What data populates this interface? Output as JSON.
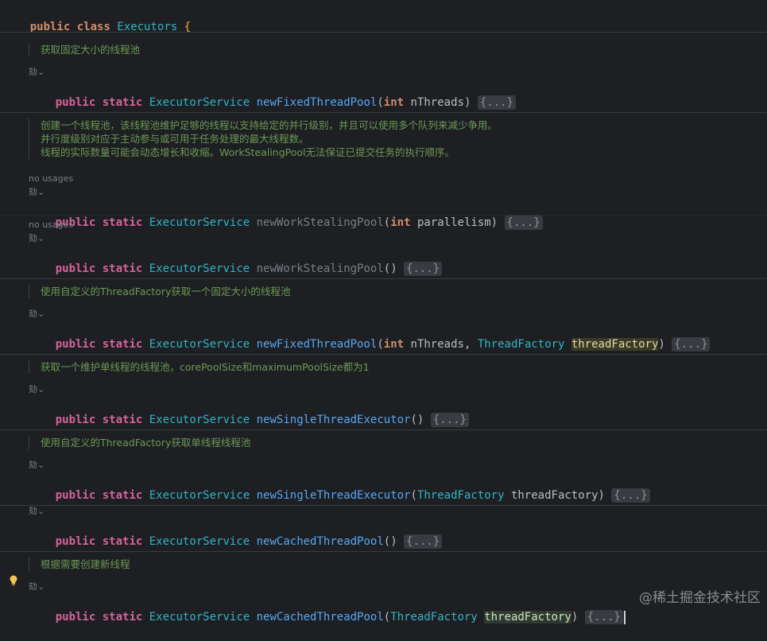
{
  "class_header": {
    "mod": "public",
    "kw": "class",
    "name": "Executors",
    "brace": "{"
  },
  "common": {
    "public": "public",
    "static": "static",
    "return_type": "ExecutorService",
    "fold": "{...}",
    "int": "int",
    "threadfactory_type": "ThreadFactory",
    "inlay": "劾⌄"
  },
  "docs": {
    "d1": "获取固定大小的线程池",
    "d2_l1": "创建一个线程池，该线程池维护足够的线程以支持给定的并行级别，并且可以使用多个队列来减少争用。",
    "d2_l2": "并行度级别对应于主动参与或可用于任务处理的最大线程数。",
    "d2_l3": "线程的实际数量可能会动态增长和收缩。WorkStealingPool无法保证已提交任务的执行顺序。",
    "d3": "使用自定义的ThreadFactory获取一个固定大小的线程池",
    "d4": "获取一个维护单线程的线程池，corePoolSize和maximumPoolSize都为1",
    "d5": "使用自定义的ThreadFactory获取单线程线程池",
    "d6": "根据需要创建新线程"
  },
  "usages": {
    "no_usages": "no usages"
  },
  "methods": {
    "m1": {
      "name": "newFixedThreadPool",
      "params": "nThreads"
    },
    "m2": {
      "name": "newWorkStealingPool",
      "params": "parallelism"
    },
    "m3": {
      "name": "newWorkStealingPool"
    },
    "m4": {
      "name": "newFixedThreadPool",
      "p1": "nThreads",
      "p2": "threadFactory"
    },
    "m5": {
      "name": "newSingleThreadExecutor"
    },
    "m6": {
      "name": "newSingleThreadExecutor",
      "p1": "threadFactory"
    },
    "m7": {
      "name": "newCachedThreadPool"
    },
    "m8": {
      "name": "newCachedThreadPool",
      "p1": "threadFactory"
    }
  },
  "watermark": "@稀土掘金技术社区",
  "colors": {
    "background": "#1e1f22",
    "keyword": "#cf8e6d",
    "type": "#2fb5c8",
    "doc": "#6a9955"
  }
}
